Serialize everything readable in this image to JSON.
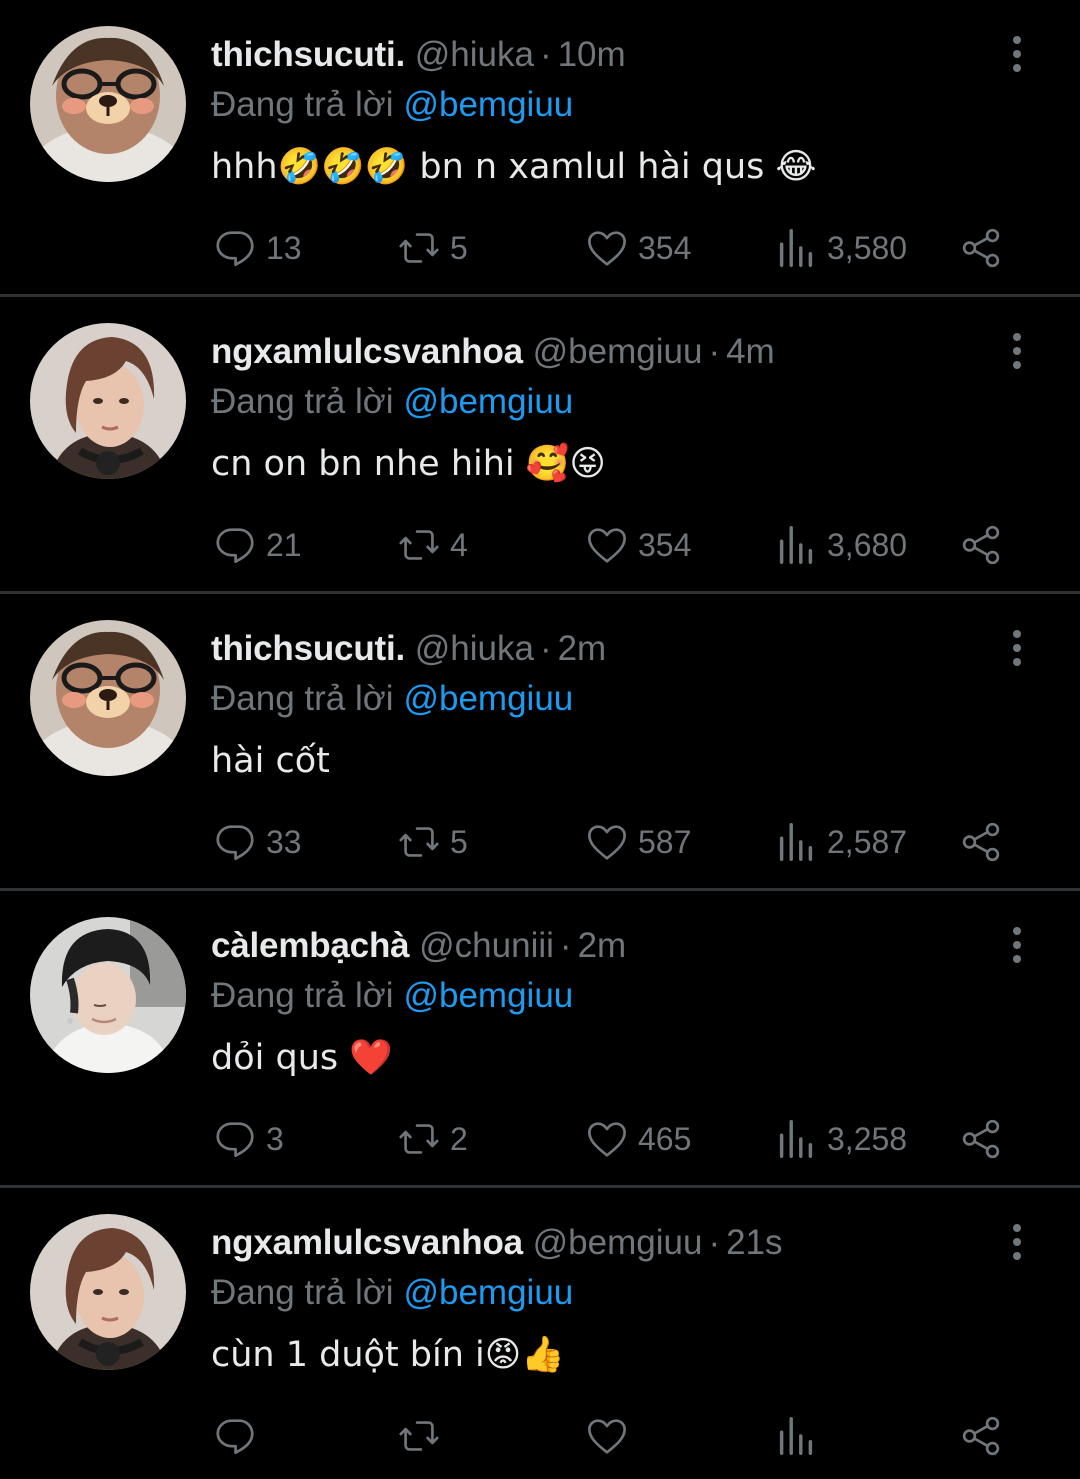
{
  "tweets": [
    {
      "name": "thichsucuti.",
      "handle": "@hiuka",
      "time": "10m",
      "replying_prefix": "Đang trả lời",
      "replying_to": "@bemgiuu",
      "text": "hhh🤣🤣🤣 bn n xamlul hài qus 😂",
      "replies": "13",
      "retweets": "5",
      "likes": "354",
      "views": "3,580"
    },
    {
      "name": "ngxamlulcsvanhoa",
      "handle": "@bemgiuu",
      "time": "4m",
      "replying_prefix": "Đang trả lời",
      "replying_to": "@bemgiuu",
      "text": "cn on bn nhe hihi 🥰😝",
      "replies": "21",
      "retweets": "4",
      "likes": "354",
      "views": "3,680"
    },
    {
      "name": "thichsucuti.",
      "handle": "@hiuka",
      "time": "2m",
      "replying_prefix": "Đang trả lời",
      "replying_to": "@bemgiuu",
      "text": "hài cốt",
      "replies": "33",
      "retweets": "5",
      "likes": "587",
      "views": "2,587"
    },
    {
      "name": "càlembạchà",
      "handle": "@chuniii",
      "time": "2m",
      "replying_prefix": "Đang trả lời",
      "replying_to": "@bemgiuu",
      "text": "dỏi qus ❤️",
      "replies": "3",
      "retweets": "2",
      "likes": "465",
      "views": "3,258"
    },
    {
      "name": "ngxamlulcsvanhoa",
      "handle": "@bemgiuu",
      "time": "21s",
      "replying_prefix": "Đang trả lời",
      "replying_to": "@bemgiuu",
      "text": "cùn 1 duột bín i😡👍",
      "replies": "",
      "retweets": "",
      "likes": "",
      "views": ""
    }
  ],
  "colors": {
    "background": "#000000",
    "text_primary": "#e7e9ea",
    "text_secondary": "#71767b",
    "link": "#1d9bf0",
    "divider": "#2f3336"
  },
  "icons": [
    "avatar-bear-filter",
    "avatar-brown-hair",
    "avatar-black-beanie",
    "more-vertical-icon",
    "reply-icon",
    "retweet-icon",
    "like-icon",
    "views-icon",
    "share-icon"
  ]
}
